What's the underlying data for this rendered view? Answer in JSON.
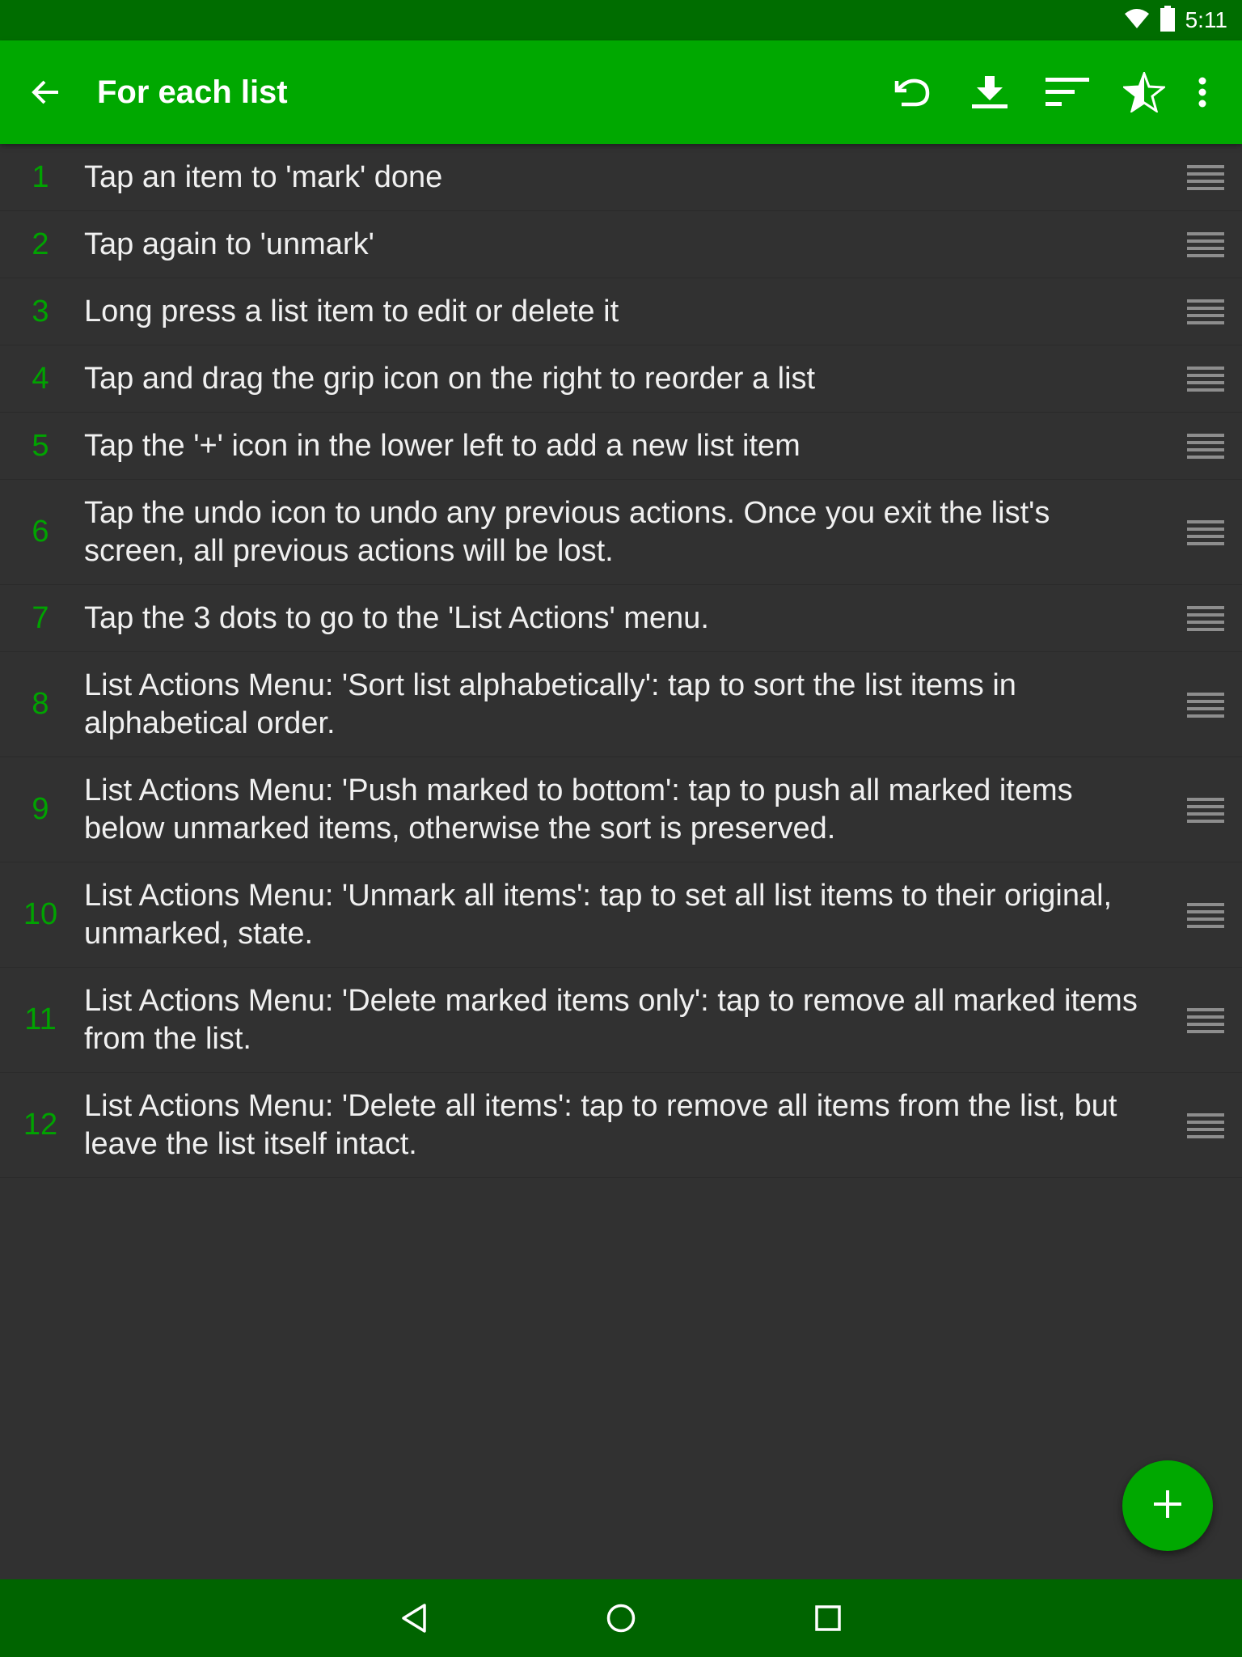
{
  "status_bar": {
    "time": "5:11",
    "icons": [
      "wifi-icon",
      "battery-icon"
    ]
  },
  "toolbar": {
    "title": "For each list",
    "icons": [
      "back-arrow-icon",
      "undo-icon",
      "download-icon",
      "sort-icon",
      "star-half-icon",
      "more-vert-icon"
    ]
  },
  "list": {
    "items": [
      {
        "num": "1",
        "text": "Tap an item to 'mark' done"
      },
      {
        "num": "2",
        "text": "Tap again to 'unmark'"
      },
      {
        "num": "3",
        "text": "Long press a list item to edit or delete it"
      },
      {
        "num": "4",
        "text": "Tap and drag the grip icon on the right to reorder a list"
      },
      {
        "num": "5",
        "text": "Tap the '+' icon in the lower left to add a new list item"
      },
      {
        "num": "6",
        "text": "Tap the undo icon to undo any previous actions.  Once you exit the list's screen, all previous actions will be lost."
      },
      {
        "num": "7",
        "text": "Tap the 3 dots to go to the 'List Actions' menu."
      },
      {
        "num": "8",
        "text": "List Actions Menu: 'Sort list alphabetically': tap to sort the list items in alphabetical order."
      },
      {
        "num": "9",
        "text": "List Actions Menu: 'Push marked to bottom': tap to push all marked items below unmarked items, otherwise the sort is preserved."
      },
      {
        "num": "10",
        "text": "List Actions Menu: 'Unmark all items': tap to set all list items to their original, unmarked, state."
      },
      {
        "num": "11",
        "text": "List Actions Menu: 'Delete marked items only': tap to remove all marked items from the list."
      },
      {
        "num": "12",
        "text": "List Actions Menu: 'Delete all items': tap to remove all items from the list, but leave the list itself intact."
      }
    ]
  },
  "fab": {
    "icon": "plus-icon"
  },
  "nav_bar": {
    "icons": [
      "back-triangle-icon",
      "home-circle-icon",
      "recents-square-icon"
    ]
  },
  "colors": {
    "status_bar": "#006d00",
    "toolbar": "#00a800",
    "background": "#313131",
    "item_number": "#00a300",
    "item_text": "#f0f0f0",
    "nav_bar": "#006400",
    "fab": "#00a800"
  }
}
